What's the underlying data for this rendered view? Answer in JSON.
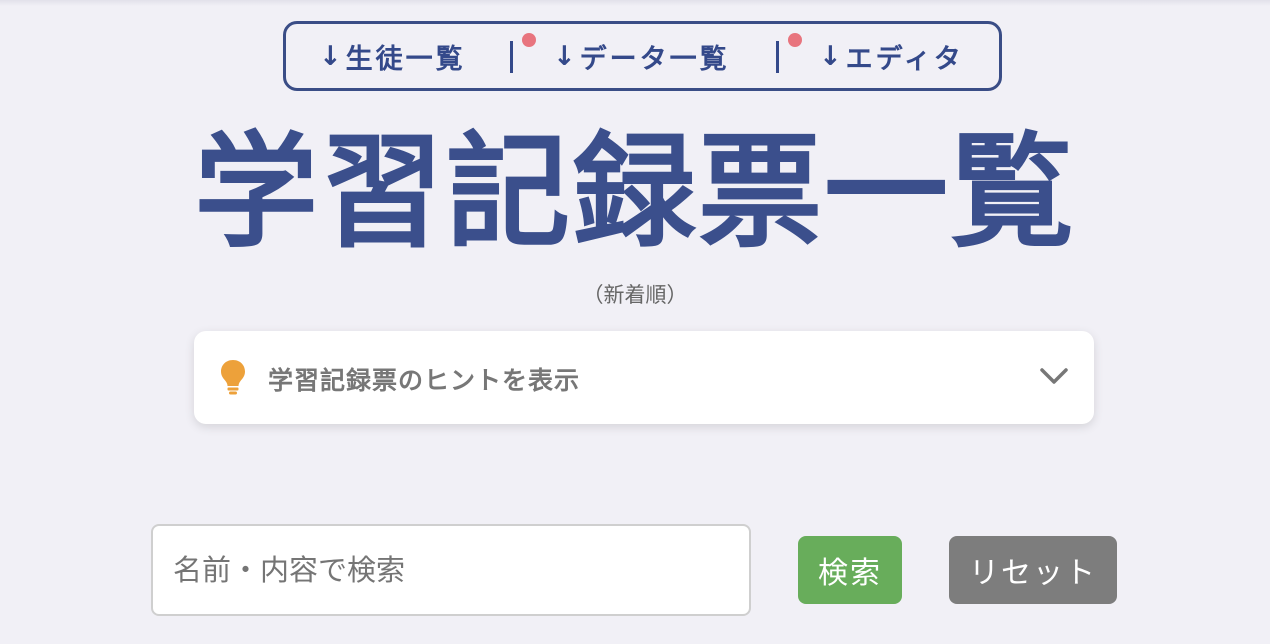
{
  "nav": {
    "items": [
      {
        "arrow": "↓",
        "label": "生徒一覧",
        "has_badge": false
      },
      {
        "arrow": "↓",
        "label": "データ一覧",
        "has_badge": true
      },
      {
        "arrow": "↓",
        "label": "エディタ",
        "has_badge": true
      }
    ],
    "separator": "|",
    "border_color": "#3a4d86",
    "badge_color": "#e8747e"
  },
  "header": {
    "title": "学習記録票一覧",
    "subtitle": "（新着順）",
    "title_color": "#3b4f8c"
  },
  "hint": {
    "icon": "lightbulb-icon",
    "label": "学習記録票のヒントを表示",
    "toggle_icon": "chevron-down-icon",
    "icon_color": "#eda13a"
  },
  "search": {
    "placeholder": "名前・内容で検索",
    "value": "",
    "search_label": "検索",
    "reset_label": "リセット",
    "search_color": "#68ad5b",
    "reset_color": "#7d7d7d"
  }
}
